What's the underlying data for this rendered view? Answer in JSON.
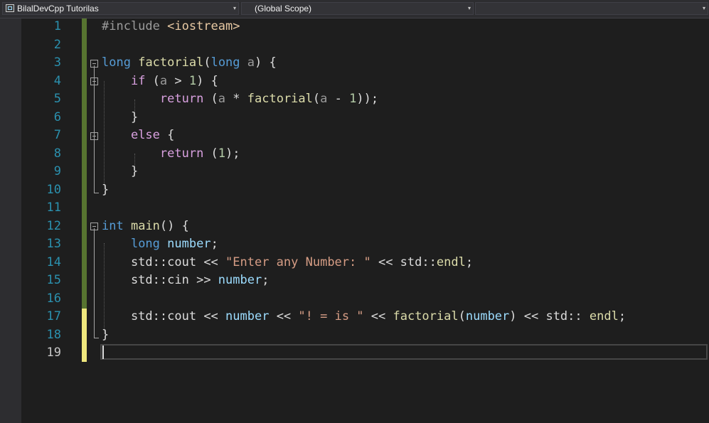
{
  "navigation": {
    "project": "BilalDevCpp Tutorilas",
    "scope": "(Global Scope)",
    "member": "",
    "dropdown_glyph": "▾"
  },
  "editor": {
    "line_numbers": [
      "1",
      "2",
      "3",
      "4",
      "5",
      "6",
      "7",
      "8",
      "9",
      "10",
      "11",
      "12",
      "13",
      "14",
      "15",
      "16",
      "17",
      "18",
      "19"
    ],
    "current_line": 19,
    "colors": {
      "keyword": "#569cd6",
      "control": "#d8a0df",
      "function": "#dcdcaa",
      "parameter": "#9a9a9a",
      "number": "#b5cea8",
      "string": "#d69d85",
      "variable": "#9cdcfe",
      "line_number": "#2b91af",
      "change_saved": "#577430",
      "change_unsaved": "#efe77d"
    },
    "code_lines": [
      [
        {
          "t": "#include ",
          "c": "t-pre"
        },
        {
          "t": "<iostream>",
          "c": "t-inc"
        }
      ],
      [],
      [
        {
          "t": "long",
          "c": "t-kw"
        },
        {
          "t": " ",
          "c": "t-txt"
        },
        {
          "t": "factorial",
          "c": "t-fn"
        },
        {
          "t": "(",
          "c": "t-txt"
        },
        {
          "t": "long",
          "c": "t-kw"
        },
        {
          "t": " ",
          "c": "t-txt"
        },
        {
          "t": "a",
          "c": "t-par"
        },
        {
          "t": ") {",
          "c": "t-txt"
        }
      ],
      [
        {
          "t": "    ",
          "c": "t-txt"
        },
        {
          "t": "if",
          "c": "t-ctl"
        },
        {
          "t": " (",
          "c": "t-txt"
        },
        {
          "t": "a",
          "c": "t-par"
        },
        {
          "t": " > ",
          "c": "t-txt"
        },
        {
          "t": "1",
          "c": "t-num"
        },
        {
          "t": ") {",
          "c": "t-txt"
        }
      ],
      [
        {
          "t": "        ",
          "c": "t-txt"
        },
        {
          "t": "return",
          "c": "t-ctl"
        },
        {
          "t": " (",
          "c": "t-txt"
        },
        {
          "t": "a",
          "c": "t-par"
        },
        {
          "t": " * ",
          "c": "t-txt"
        },
        {
          "t": "factorial",
          "c": "t-fn"
        },
        {
          "t": "(",
          "c": "t-txt"
        },
        {
          "t": "a",
          "c": "t-par"
        },
        {
          "t": " - ",
          "c": "t-txt"
        },
        {
          "t": "1",
          "c": "t-num"
        },
        {
          "t": "));",
          "c": "t-txt"
        }
      ],
      [
        {
          "t": "    }",
          "c": "t-txt"
        }
      ],
      [
        {
          "t": "    ",
          "c": "t-txt"
        },
        {
          "t": "else",
          "c": "t-ctl"
        },
        {
          "t": " {",
          "c": "t-txt"
        }
      ],
      [
        {
          "t": "        ",
          "c": "t-txt"
        },
        {
          "t": "return",
          "c": "t-ctl"
        },
        {
          "t": " (",
          "c": "t-txt"
        },
        {
          "t": "1",
          "c": "t-num"
        },
        {
          "t": ");",
          "c": "t-txt"
        }
      ],
      [
        {
          "t": "    }",
          "c": "t-txt"
        }
      ],
      [
        {
          "t": "}",
          "c": "t-txt"
        }
      ],
      [],
      [
        {
          "t": "int",
          "c": "t-kw"
        },
        {
          "t": " ",
          "c": "t-txt"
        },
        {
          "t": "main",
          "c": "t-fn"
        },
        {
          "t": "() {",
          "c": "t-txt"
        }
      ],
      [
        {
          "t": "    ",
          "c": "t-txt"
        },
        {
          "t": "long",
          "c": "t-kw"
        },
        {
          "t": " ",
          "c": "t-txt"
        },
        {
          "t": "number",
          "c": "t-var"
        },
        {
          "t": ";",
          "c": "t-txt"
        }
      ],
      [
        {
          "t": "    std::",
          "c": "t-txt"
        },
        {
          "t": "cout",
          "c": "t-txt"
        },
        {
          "t": " << ",
          "c": "t-txt"
        },
        {
          "t": "\"Enter any Number: \"",
          "c": "t-str"
        },
        {
          "t": " << std::",
          "c": "t-txt"
        },
        {
          "t": "endl",
          "c": "t-fn"
        },
        {
          "t": ";",
          "c": "t-txt"
        }
      ],
      [
        {
          "t": "    std::",
          "c": "t-txt"
        },
        {
          "t": "cin",
          "c": "t-txt"
        },
        {
          "t": " >> ",
          "c": "t-txt"
        },
        {
          "t": "number",
          "c": "t-var"
        },
        {
          "t": ";",
          "c": "t-txt"
        }
      ],
      [],
      [
        {
          "t": "    std::",
          "c": "t-txt"
        },
        {
          "t": "cout",
          "c": "t-txt"
        },
        {
          "t": " << ",
          "c": "t-txt"
        },
        {
          "t": "number",
          "c": "t-var"
        },
        {
          "t": " << ",
          "c": "t-txt"
        },
        {
          "t": "\"! = is \"",
          "c": "t-str"
        },
        {
          "t": " << ",
          "c": "t-txt"
        },
        {
          "t": "factorial",
          "c": "t-fn"
        },
        {
          "t": "(",
          "c": "t-txt"
        },
        {
          "t": "number",
          "c": "t-var"
        },
        {
          "t": ") << std:: ",
          "c": "t-txt"
        },
        {
          "t": "endl",
          "c": "t-fn"
        },
        {
          "t": ";",
          "c": "t-txt"
        }
      ],
      [
        {
          "t": "}",
          "c": "t-txt"
        }
      ],
      []
    ]
  }
}
